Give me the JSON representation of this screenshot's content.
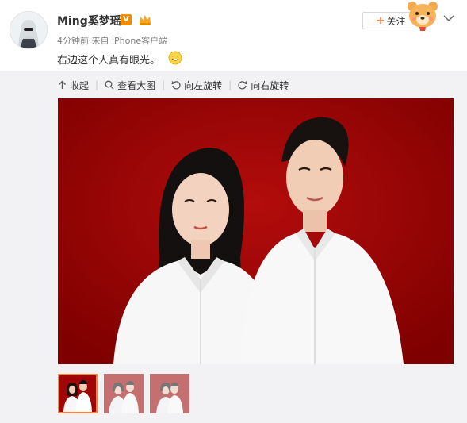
{
  "user": {
    "name": "Ming奚梦瑶",
    "verified_badge": "V",
    "meta": "4分钟前 来自 iPhone客户端"
  },
  "post": {
    "text": "右边这个人真有眼光。"
  },
  "follow": {
    "plus": "+",
    "label": "关注"
  },
  "toolbar": {
    "collapse": "收起",
    "view_large": "查看大图",
    "rotate_left": "向左旋转",
    "rotate_right": "向右旋转"
  },
  "icons": [
    "avatar",
    "vip-badge-icon",
    "crown-icon",
    "smile-emoji-icon",
    "mascot-icon",
    "chevron-down-icon",
    "arrow-up-icon",
    "search-icon",
    "rotate-left-icon",
    "rotate-right-icon"
  ],
  "colors": {
    "accent": "#ff8140",
    "photo_bg": "#9e0000",
    "media_bg": "#f2f2f5"
  },
  "thumbnails": [
    {
      "state": "selected"
    },
    {
      "state": "normal"
    },
    {
      "state": "normal"
    }
  ]
}
